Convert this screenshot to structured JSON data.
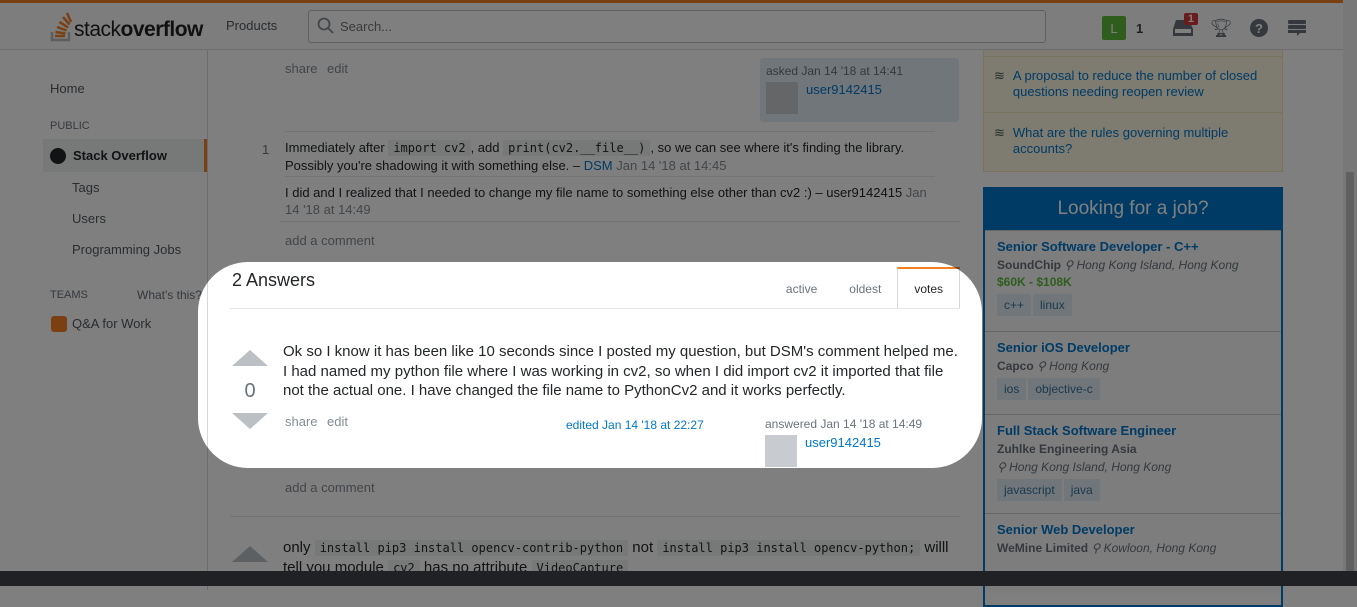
{
  "header": {
    "logo_text_light": "stack",
    "logo_text_bold": "overflow",
    "products": "Products",
    "search_placeholder": "Search...",
    "user_initial": "L",
    "reputation": "1",
    "inbox_count": "1",
    "accent": "#f48024"
  },
  "sidebar": {
    "home": "Home",
    "public": "PUBLIC",
    "stack_overflow": "Stack Overflow",
    "tags": "Tags",
    "users": "Users",
    "jobs": "Programming Jobs",
    "teams": "TEAMS",
    "whats_this": "What's this?",
    "qa_for_work": "Q&A for Work"
  },
  "question": {
    "share": "share",
    "edit": "edit",
    "asked": "asked Jan 14 '18 at 14:41",
    "user": "user9142415",
    "comments": [
      {
        "score": "1",
        "pre": "Immediately after ",
        "code1": "import cv2",
        "mid": ", add ",
        "code2": "print(cv2.__file__)",
        "post": ", so we can see where it's finding the library. Possibly you're shadowing it with something else. – ",
        "user": "DSM",
        "date": "Jan 14 '18 at 14:45"
      },
      {
        "score": "",
        "text": "I did and I realized that I needed to change my file name to something else other than cv2 :) – user9142415 ",
        "date": "Jan 14 '18 at 14:49"
      }
    ],
    "add_comment": "add a comment"
  },
  "answers": {
    "count_label": "2 Answers",
    "tabs": [
      "active",
      "oldest",
      "votes"
    ],
    "active_tab": "votes",
    "first": {
      "votes": "0",
      "body": "Ok so I know it has been like 10 seconds since I posted my question, but DSM's comment helped me. I had named my python file where I was working in cv2, so when I did import cv2 it imported that file not the actual one. I have changed the file name to PythonCv2 and it works perfectly.",
      "share": "share",
      "edit": "edit",
      "edited": "edited Jan 14 '18 at 22:27",
      "answered": "answered Jan 14 '18 at 14:49",
      "user": "user9142415",
      "add_comment": "add a comment"
    },
    "second": {
      "t1": "only ",
      "c1": "install pip3 install opencv-contrib-python",
      "t2": " not ",
      "c2": "install  pip3 install opencv-python;",
      "t3": " willl tell you module ",
      "c3": "cv2",
      "t4": " has no attribute ",
      "c4": "VideoCapture"
    }
  },
  "meta": {
    "items": [
      "A proposal to reduce the number of closed questions needing reopen review",
      "What are the rules governing multiple accounts?"
    ]
  },
  "jobs": {
    "title": "Looking for a job?",
    "items": [
      {
        "title": "Senior Software Developer - C++",
        "company": "SoundChip",
        "location": "Hong Kong Island, Hong Kong",
        "salary": "$60K - $108K",
        "tags": [
          "c++",
          "linux"
        ]
      },
      {
        "title": "Senior iOS Developer",
        "company": "Capco",
        "location": "Hong Kong",
        "tags": [
          "ios",
          "objective-c"
        ]
      },
      {
        "title": "Full Stack Software Engineer",
        "company": "Zuhlke Engineering Asia",
        "location": "Hong Kong Island, Hong Kong",
        "tags": [
          "javascript",
          "java"
        ]
      },
      {
        "title": "Senior Web Developer",
        "company": "WeMine Limited",
        "location": "Kowloon, Hong Kong",
        "tags": []
      }
    ]
  }
}
